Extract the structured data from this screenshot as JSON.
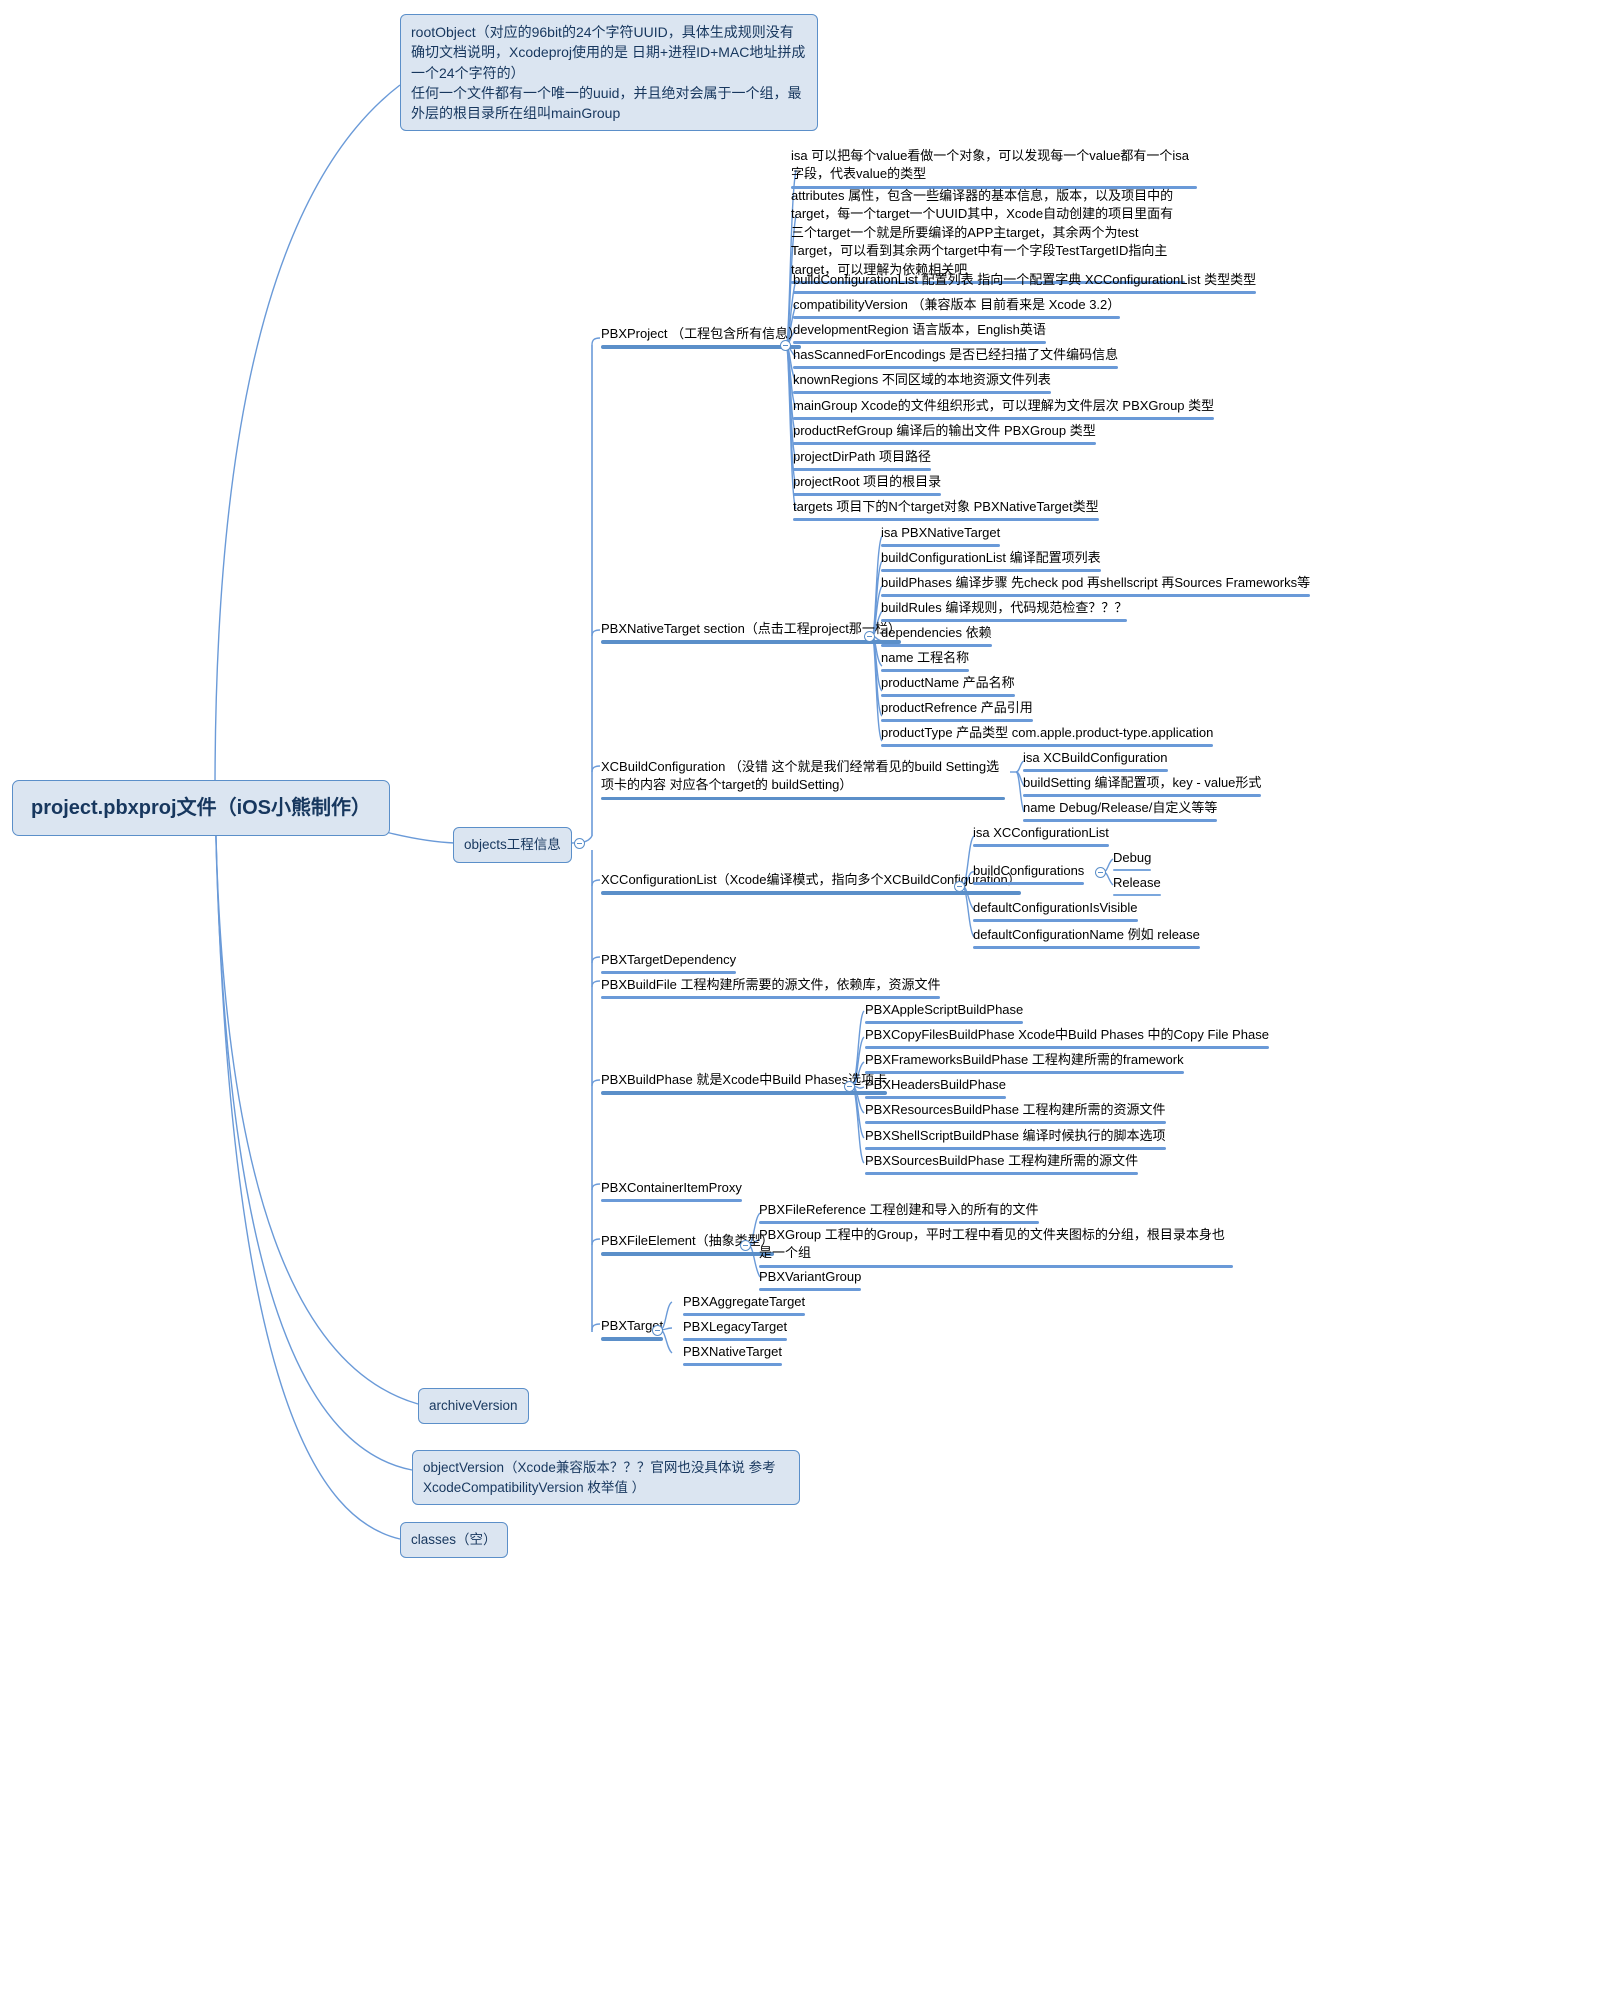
{
  "root": {
    "label": "project.pbxproj文件（iOS小熊制作）"
  },
  "callouts": {
    "root_object": "rootObject（对应的96bit的24个字符UUID，具体生成规则没有确切文档说明，Xcodeproj使用的是 日期+进程ID+MAC地址拼成一个24个字符的）\n任何一个文件都有一个唯一的uuid，并且绝对会属于一个组，最外层的根目录所在组叫mainGroup",
    "objects": "objects工程信息",
    "archive_version": "archiveVersion",
    "object_version": "objectVersion（Xcode兼容版本？？？官网也没具体说 参考 XcodeCompatibilityVersion 枚举值   ）",
    "classes": "classes（空）"
  },
  "pbx_project": {
    "label": "PBXProject （工程包含所有信息）",
    "isa_note": "isa 可以把每个value看做一个对象，可以发现每一个value都有一个isa字段，代表value的类型",
    "attributes_note": "attributes 属性，包含一些编译器的基本信息，版本，以及项目中的target，每一个target一个UUID其中，Xcode自动创建的项目里面有三个target一个就是所要编译的APP主target，其余两个为test Target，可以看到其余两个target中有一个字段TestTargetID指向主target，可以理解为依赖相关吧",
    "items": [
      "buildConfigurationList 配置列表 指向一个配置字典 XCConfigurationList 类型类型",
      "compatibilityVersion （兼容版本 目前看来是 Xcode 3.2）",
      "developmentRegion 语言版本，English英语",
      "hasScannedForEncodings 是否已经扫描了文件编码信息",
      "knownRegions 不同区域的本地资源文件列表",
      "mainGroup Xcode的文件组织形式，可以理解为文件层次 PBXGroup 类型",
      "productRefGroup 编译后的输出文件 PBXGroup 类型",
      "projectDirPath 项目路径",
      "projectRoot 项目的根目录",
      "targets 项目下的N个target对象 PBXNativeTarget类型"
    ]
  },
  "pbx_native_target": {
    "label": "PBXNativeTarget  section（点击工程project那一栏）",
    "items": [
      "isa PBXNativeTarget",
      "buildConfigurationList 编译配置项列表",
      "buildPhases 编译步骤 先check pod 再shellscript 再Sources Frameworks等",
      "buildRules 编译规则，代码规范检查？？？",
      "dependencies 依赖",
      "name 工程名称",
      "productName 产品名称",
      "productRefrence 产品引用",
      "productType 产品类型  com.apple.product-type.application"
    ]
  },
  "xc_build_configuration": {
    "label": "XCBuildConfiguration （没错 这个就是我们经常看见的build Setting选项卡的内容 对应各个target的  buildSetting）",
    "items": [
      "isa   XCBuildConfiguration",
      "buildSetting 编译配置项，key - value形式",
      "name  Debug/Release/自定义等等"
    ]
  },
  "xc_configuration_list": {
    "label": "XCConfigurationList（Xcode编译模式，指向多个XCBuildConfiguration）",
    "items": [
      "isa XCConfigurationList",
      "buildConfigurations",
      "defaultConfigurationIsVisible",
      "defaultConfigurationName   例如 release"
    ],
    "build_configurations_children": [
      "Debug",
      "Release"
    ]
  },
  "misc_nodes": {
    "target_dependency": "PBXTargetDependency",
    "build_file": "PBXBuildFile 工程构建所需要的源文件，依赖库，资源文件",
    "container_item_proxy": "PBXContainerItemProxy"
  },
  "pbx_build_phase": {
    "label": "PBXBuildPhase  就是Xcode中Build Phases选项卡",
    "items": [
      "PBXAppleScriptBuildPhase",
      "PBXCopyFilesBuildPhase Xcode中Build Phases 中的Copy File Phase",
      "PBXFrameworksBuildPhase 工程构建所需的framework",
      "PBXHeadersBuildPhase",
      "PBXResourcesBuildPhase 工程构建所需的资源文件",
      "PBXShellScriptBuildPhase 编译时候执行的脚本选项",
      "PBXSourcesBuildPhase 工程构建所需的源文件"
    ]
  },
  "pbx_file_element": {
    "label": "PBXFileElement（抽象类型）",
    "items": [
      "PBXFileReference 工程创建和导入的所有的文件",
      "PBXGroup 工程中的Group，平时工程中看见的文件夹图标的分组，根目录本身也是一个组",
      "PBXVariantGroup"
    ]
  },
  "pbx_target": {
    "label": "PBXTarget",
    "items": [
      "PBXAggregateTarget",
      "PBXLegacyTarget",
      "PBXNativeTarget"
    ]
  },
  "colors": {
    "node_fill": "#dbe5f1",
    "node_border": "#5b8fc9",
    "link": "#6a9ad8",
    "root_text": "#17375e",
    "leaf_text": "#000000"
  }
}
